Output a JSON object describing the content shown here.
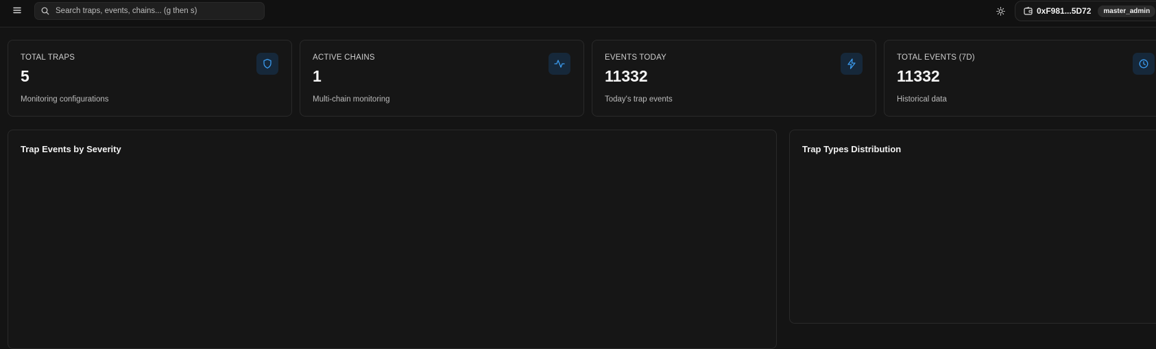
{
  "header": {
    "search_placeholder": "Search traps, events, chains... (g then s)",
    "wallet_address": "0xF981...5D72",
    "role_badge": "master_admin",
    "icons": {
      "menu": "menu-icon",
      "search": "search-icon",
      "theme": "sun-icon",
      "wallet": "wallet-icon",
      "dropdown": "chevron-down-icon"
    }
  },
  "stats": [
    {
      "label": "TOTAL TRAPS",
      "value": "5",
      "sub": "Monitoring configurations",
      "icon": "shield-icon"
    },
    {
      "label": "ACTIVE CHAINS",
      "value": "1",
      "sub": "Multi-chain monitoring",
      "icon": "activity-icon"
    },
    {
      "label": "EVENTS TODAY",
      "value": "11332",
      "sub": "Today's trap events",
      "icon": "lightning-icon"
    },
    {
      "label": "TOTAL EVENTS (7D)",
      "value": "11332",
      "sub": "Historical data",
      "icon": "clock-icon"
    }
  ],
  "panels": {
    "severity_title": "Trap Events by Severity",
    "types_title": "Trap Types Distribution"
  },
  "colors": {
    "accent": "#3b9cf0",
    "badge_bg": "#16283a",
    "background": "#141414",
    "card": "#161616"
  }
}
